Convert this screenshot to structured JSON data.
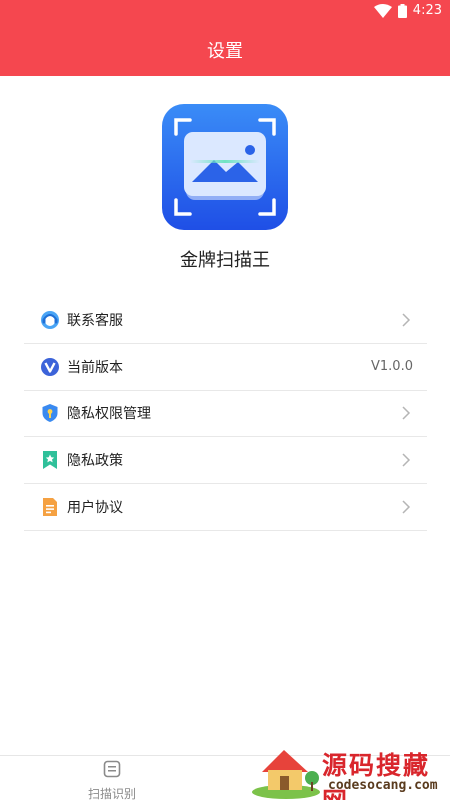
{
  "status_bar": {
    "time": "4:23",
    "icons": [
      "wifi-icon",
      "battery-icon"
    ]
  },
  "header": {
    "title": "设置"
  },
  "app": {
    "name": "金牌扫描王"
  },
  "menu": {
    "items": [
      {
        "label": "联系客服",
        "icon": "customer-service-icon",
        "chevron": true
      },
      {
        "label": "当前版本",
        "icon": "version-icon",
        "value": "V1.0.0"
      },
      {
        "label": "隐私权限管理",
        "icon": "privacy-shield-icon",
        "chevron": true
      },
      {
        "label": "隐私政策",
        "icon": "bookmark-star-icon",
        "chevron": true
      },
      {
        "label": "用户协议",
        "icon": "document-icon",
        "chevron": true
      }
    ]
  },
  "tabbar": {
    "scan_label": "扫描识别"
  },
  "watermark": {
    "title": "源码搜藏网",
    "url": "codesocang.com"
  },
  "colors": {
    "header": "#f5474f",
    "accent_blue": "#2f6df0"
  }
}
